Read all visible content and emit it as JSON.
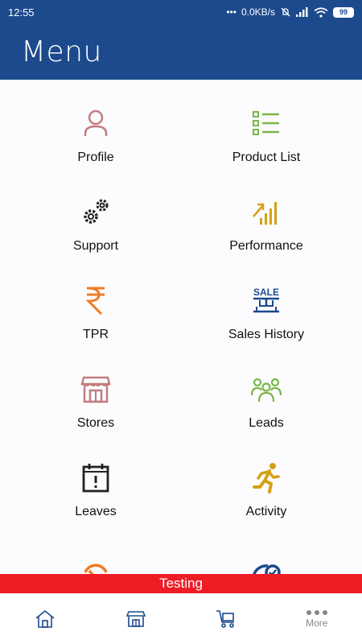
{
  "status_bar": {
    "time": "12:55",
    "network_speed": "0.0KB/s",
    "battery": "99"
  },
  "header": {
    "title": "Menu"
  },
  "menu": {
    "items": [
      {
        "label": "Profile",
        "icon": "profile-icon",
        "color": "#c27d7d"
      },
      {
        "label": "Product List",
        "icon": "product-list-icon",
        "color": "#7ab648"
      },
      {
        "label": "Support",
        "icon": "gears-icon",
        "color": "#222222"
      },
      {
        "label": "Performance",
        "icon": "performance-icon",
        "color": "#d4a017"
      },
      {
        "label": "TPR",
        "icon": "rupee-icon",
        "color": "#f07c26"
      },
      {
        "label": "Sales History",
        "icon": "sale-icon",
        "color": "#1c4a8c"
      },
      {
        "label": "Stores",
        "icon": "store-icon",
        "color": "#c27d7d"
      },
      {
        "label": "Leads",
        "icon": "leads-icon",
        "color": "#7ab648"
      },
      {
        "label": "Leaves",
        "icon": "calendar-icon",
        "color": "#222222"
      },
      {
        "label": "Activity",
        "icon": "running-icon",
        "color": "#d4a017"
      }
    ]
  },
  "banner": {
    "text": "Testing"
  },
  "bottom_nav": {
    "items": [
      {
        "icon": "home-icon"
      },
      {
        "icon": "store-icon"
      },
      {
        "icon": "cart-icon"
      },
      {
        "icon": "more-icon",
        "label": "More"
      }
    ]
  }
}
